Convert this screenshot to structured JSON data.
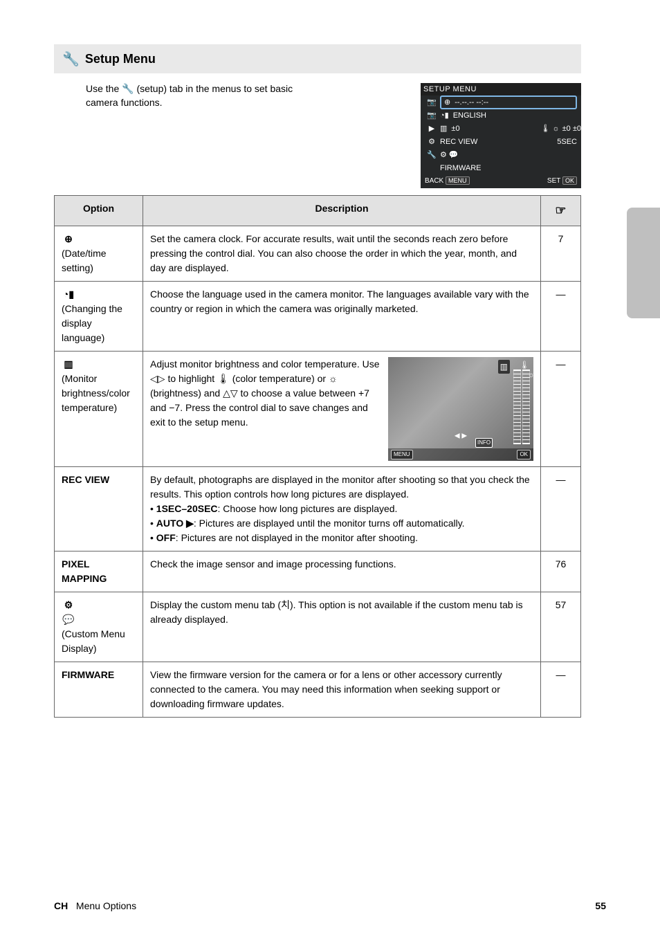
{
  "header": {
    "icon": "🔧",
    "title": "Setup Menu"
  },
  "intro": {
    "line1_prefix": "Use the ",
    "icon": "🔧",
    "line1_suffix": " (setup) tab in the menus to set basic",
    "line2": "camera functions."
  },
  "menu_graphic": {
    "title": "SETUP MENU",
    "rows": [
      {
        "icon": "⊕",
        "text": "--.--.-- --:--"
      },
      {
        "icon": "◔▮",
        "text": "ENGLISH"
      },
      {
        "icon": "▥",
        "text": "±0",
        "extra_icons": "🌡  ☼",
        "extra_values": "±0  ±0"
      },
      {
        "icon": "▶",
        "text": "REC VIEW",
        "value": "5SEC"
      },
      {
        "icon": "⚙",
        "text": "",
        "gears": "⚙ 💬",
        "value": ""
      },
      {
        "icon": "🔧",
        "text": "FIRMWARE"
      }
    ],
    "back_label": "BACK",
    "menu_key": "MENU",
    "set_label": "SET",
    "ok_key": "OK"
  },
  "table": {
    "head_option": "Option",
    "head_desc": "Description",
    "head_ref_icon": "☞",
    "rows": [
      {
        "opt_icon": "⊕",
        "opt_text": "(Date/time setting)",
        "desc": "Set the camera clock. For accurate results, wait until the seconds reach zero before pressing the control dial. You can also choose the order in which the year, month, and day are displayed.",
        "page": "7"
      },
      {
        "opt_icon": "◔▮",
        "opt_text": "(Changing the display language)",
        "desc": "Choose the language used in the camera monitor. The languages available vary with the country or region in which the camera was originally marketed.",
        "page": "—"
      },
      {
        "opt_icon": "▥",
        "opt_text": "(Monitor brightness/color temperature)",
        "desc_p1_before": "Adjust monitor brightness and color temperature. Use ",
        "desc_arrows_lr": "◁▷",
        "desc_p1_mid": " to highlight ",
        "desc_temp": "🌡",
        "desc_p1_mid2": " (color temperature) or ",
        "desc_sun": "☼",
        "desc_p1_after": " (brightness) and ",
        "desc_arrows_ud": "△▽",
        "desc_p1_end": " to choose a value between +7 and −7. Press the control dial to save changes and exit to the setup menu.",
        "page": "—",
        "has_preview": true
      },
      {
        "opt_text_bold": "REC VIEW",
        "desc_main": "By default, photographs are displayed in the monitor after shooting so that you check the results. This option controls how long pictures are displayed.",
        "bullets": [
          {
            "b": "1SEC–20SEC",
            "t": ": Choose how long pictures are displayed."
          },
          {
            "b": "AUTO ▶",
            "t": ": Pictures are displayed until the monitor turns off automatically."
          },
          {
            "b": "OFF",
            "t": ": Pictures are not displayed in the monitor after shooting."
          }
        ],
        "page": "—"
      },
      {
        "opt_text_bold": "PIXEL MAPPING",
        "desc": "Check the image sensor and image processing functions.",
        "page": "76"
      },
      {
        "opt_icon": "⚙ 💬",
        "opt_text": "(Custom Menu Display)",
        "desc": "Display the custom menu tab (치). This option is not available if the custom menu tab is already displayed.",
        "page": "57"
      },
      {
        "opt_text_bold": "FIRMWARE",
        "desc": "View the firmware version for the camera or for a lens or other accessory currently connected to the camera. You may need this information when seeking support or downloading firmware updates.",
        "page": "—"
      }
    ]
  },
  "footer": {
    "ch": "CH",
    "title": "Menu Options",
    "page": "55"
  }
}
